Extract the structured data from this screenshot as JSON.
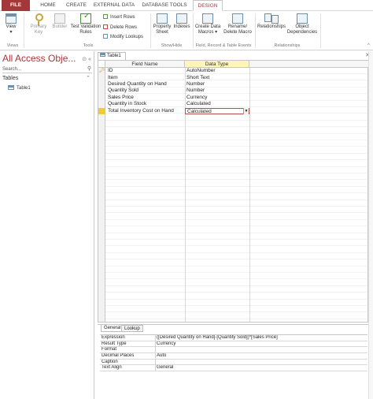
{
  "ribbon_tabs": [
    "FILE",
    "HOME",
    "CREATE",
    "EXTERNAL DATA",
    "DATABASE TOOLS",
    "DESIGN"
  ],
  "ribbon": {
    "view": "View",
    "primary_key": [
      "Primary",
      "Key"
    ],
    "builder": "Builder",
    "test_validation": [
      "Test Validation",
      "Rules"
    ],
    "insert_rows": "Insert Rows",
    "delete_rows": "Delete Rows",
    "modify_lookups": "Modify Lookups",
    "property_sheet": [
      "Property",
      "Sheet"
    ],
    "indexes": "Indexes",
    "create_data_macros": [
      "Create Data",
      "Macros ▾"
    ],
    "rename_delete_macro": [
      "Rename/",
      "Delete Macro"
    ],
    "relationships": "Relationships",
    "object_dependencies": [
      "Object",
      "Dependencies"
    ],
    "groups": {
      "views": "Views",
      "tools": "Tools",
      "show_hide": "Show/Hide",
      "field_record": "Field, Record & Table Events",
      "relationships": "Relationships"
    }
  },
  "nav": {
    "title": "All Access Obje...",
    "search_placeholder": "Search...",
    "group": "Tables",
    "items": [
      "Table1"
    ]
  },
  "document_tab": "Table1",
  "grid": {
    "headers": {
      "field_name": "Field Name",
      "data_type": "Data Type",
      "description": ""
    },
    "rows": [
      {
        "field": "ID",
        "type": "AutoNumber",
        "primary": true
      },
      {
        "field": "Item",
        "type": "Short Text"
      },
      {
        "field": "Desired Quantity on Hand",
        "type": "Number"
      },
      {
        "field": "Quantity Sold",
        "type": "Number"
      },
      {
        "field": "Sales Price",
        "type": "Currency"
      },
      {
        "field": "Quantity in Stock",
        "type": "Calculated"
      },
      {
        "field": "Total Inventory Cost on Hand",
        "type": "Calculated",
        "current": true
      }
    ]
  },
  "properties": {
    "tabs": [
      "General",
      "Lookup"
    ],
    "rows": [
      {
        "name": "Expression",
        "value": "([Desired Quantity on Hand]-[Quantity Sold])*[Sales Price]"
      },
      {
        "name": "Result Type",
        "value": "Currency"
      },
      {
        "name": "Format",
        "value": ""
      },
      {
        "name": "Decimal Places",
        "value": "Auto"
      },
      {
        "name": "Caption",
        "value": ""
      },
      {
        "name": "Text Align",
        "value": "General"
      }
    ]
  },
  "colors": {
    "accent": "#a4373a",
    "selected_header": "#fff5b8",
    "current_row": "#f3c93a"
  }
}
